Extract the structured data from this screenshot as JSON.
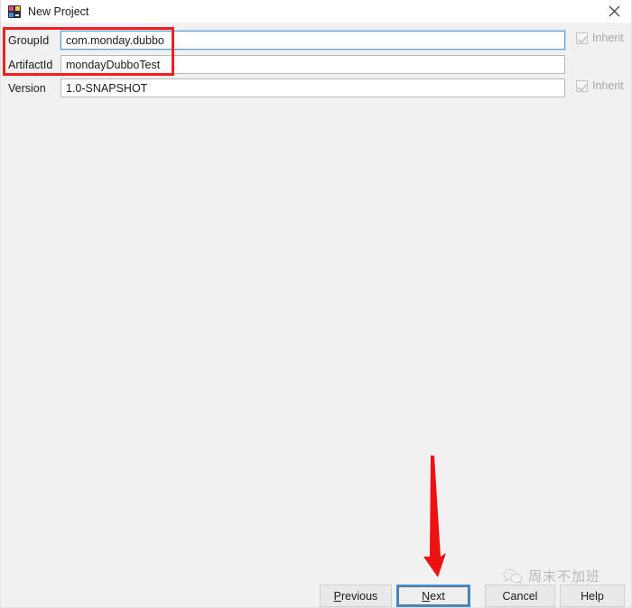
{
  "window": {
    "title": "New Project",
    "icon": "intellij-idea-icon",
    "close_icon": "close-icon"
  },
  "form": {
    "rows": [
      {
        "label": "GroupId",
        "value": "com.monday.dubbo",
        "focused": true,
        "has_inherit": true,
        "inherit_label": "Inherit",
        "inherit_checked": true,
        "inherit_disabled": true
      },
      {
        "label": "ArtifactId",
        "value": "mondayDubboTest",
        "focused": false,
        "has_inherit": false,
        "inherit_label": "",
        "inherit_checked": false,
        "inherit_disabled": false
      },
      {
        "label": "Version",
        "value": "1.0-SNAPSHOT",
        "focused": false,
        "has_inherit": true,
        "inherit_label": "Inherit",
        "inherit_checked": true,
        "inherit_disabled": true
      }
    ]
  },
  "annotations": {
    "highlight_color": "#f21f1f",
    "arrow_color": "#ee1111",
    "arrow_name": "red-down-arrow",
    "highlight_name": "red-highlight-rectangle"
  },
  "watermark": {
    "text": "周末不加班",
    "icon": "wechat-icon"
  },
  "buttons": {
    "previous": {
      "mnemonic": "P",
      "rest": "revious"
    },
    "next": {
      "mnemonic": "N",
      "rest": "ext"
    },
    "cancel": {
      "label": "Cancel"
    },
    "help": {
      "label": "Help"
    }
  }
}
